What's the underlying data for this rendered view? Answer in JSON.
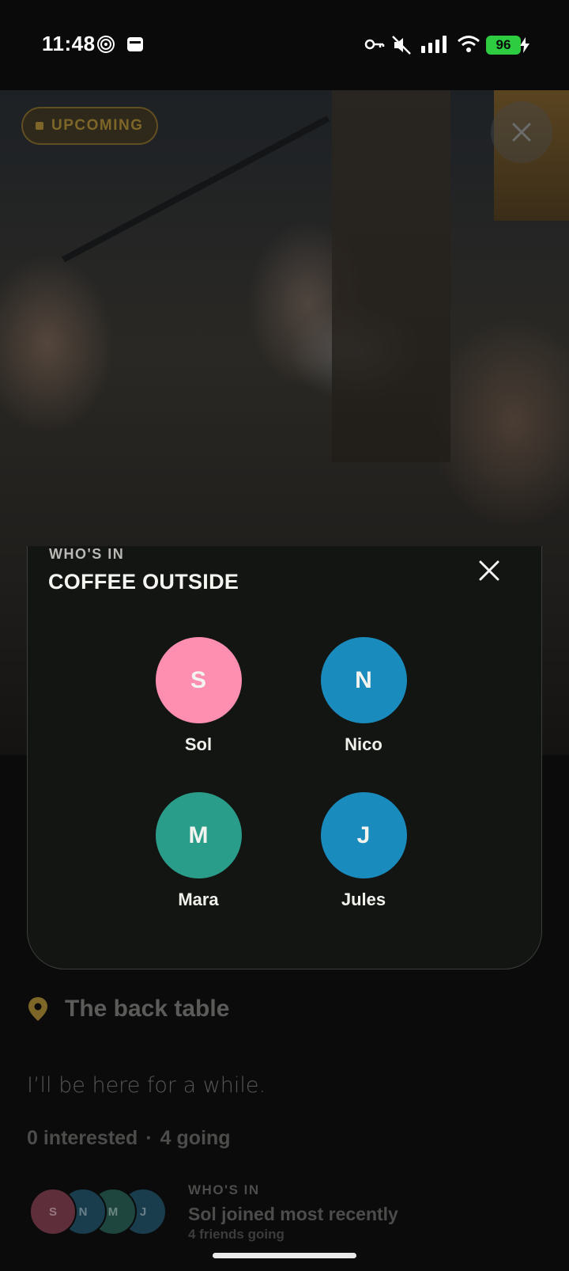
{
  "status_bar": {
    "time": "11:48",
    "battery": "96",
    "icons": [
      "hotspot-icon",
      "wallet-icon",
      "key-icon",
      "mute-icon",
      "signal-icon",
      "wifi-icon",
      "charging-icon"
    ]
  },
  "hero": {
    "badge": "UPCOMING"
  },
  "modal": {
    "eyebrow": "WHO'S IN",
    "title": "COFFEE OUTSIDE",
    "people": [
      {
        "initial": "S",
        "name": "Sol",
        "color": "#ff8fb1"
      },
      {
        "initial": "N",
        "name": "Nico",
        "color": "#1a8bbd"
      },
      {
        "initial": "M",
        "name": "Mara",
        "color": "#2a9d8a"
      },
      {
        "initial": "J",
        "name": "Jules",
        "color": "#1a8bbd"
      }
    ]
  },
  "event": {
    "location": "The back table",
    "note": "I’ll be here for a while.",
    "interested": "0 interested",
    "separator": "·",
    "going": "4 going"
  },
  "recent": {
    "initials": [
      "S",
      "N",
      "M",
      "J"
    ],
    "eyebrow": "WHO'S IN",
    "title": "Sol joined most recently",
    "subtitle": "4 friends going"
  },
  "colors": {
    "accent_gold": "#7d6628",
    "background": "#0b0b0c",
    "modal": "#131513"
  }
}
